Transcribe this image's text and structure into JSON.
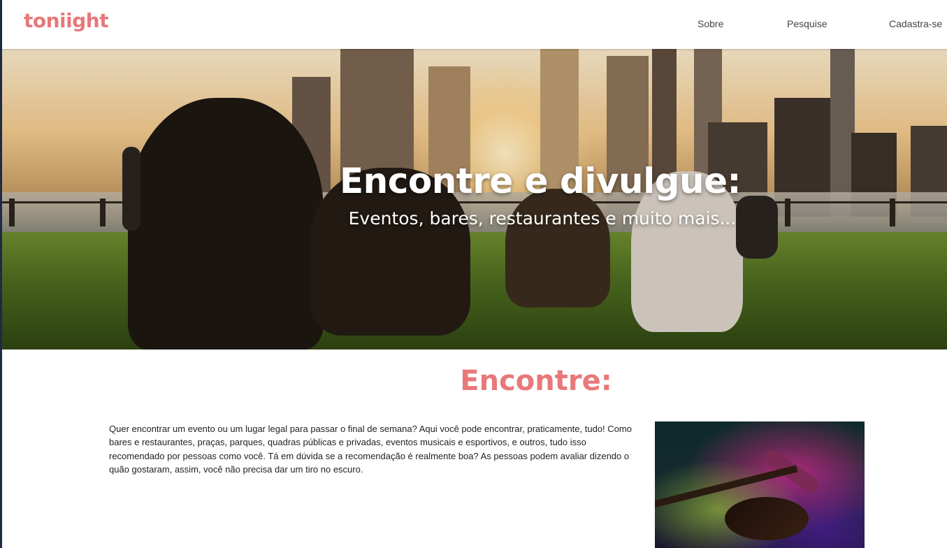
{
  "app": {
    "logo": "toniight"
  },
  "nav": {
    "items": [
      {
        "label": "Sobre"
      },
      {
        "label": "Pesquise"
      },
      {
        "label": "Cadastra-se"
      }
    ]
  },
  "hero": {
    "title": "Encontre e divulgue:",
    "subtitle": "Eventos, bares, restaurantes e muito mais..."
  },
  "section": {
    "title": "Encontre:",
    "text": "Quer encontrar um evento ou um lugar legal para passar o final de semana? Aqui você pode encontrar, praticamente, tudo! Como bares e restaurantes, praças, parques, quadras públicas e privadas, eventos musicais e esportivos, e outros, tudo isso recomendado por pessoas como você. Tá em dúvida se a recomendação é realmente boa? As pessoas podem avaliar dizendo o quão gostaram, assim, você não precisa dar um tiro no escuro."
  },
  "colors": {
    "brand": "#e8787a",
    "nav_text": "#444444",
    "body_text": "#222222"
  }
}
